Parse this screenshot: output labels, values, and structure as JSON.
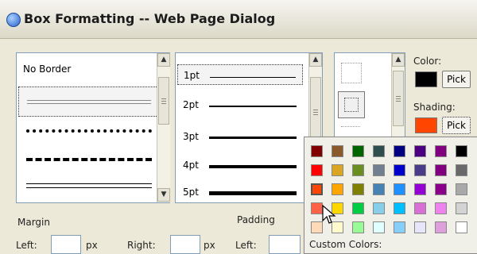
{
  "window": {
    "title": "Box Formatting -- Web Page Dialog"
  },
  "border_list": {
    "items": [
      {
        "label": "No Border",
        "style": "none"
      },
      {
        "label": "",
        "style": "double-thin"
      },
      {
        "label": "",
        "style": "dotted"
      },
      {
        "label": "",
        "style": "dashed"
      },
      {
        "label": "",
        "style": "double"
      }
    ],
    "selected": 1
  },
  "width_list": {
    "items": [
      {
        "label": "1pt",
        "weight": 1
      },
      {
        "label": "2pt",
        "weight": 2
      },
      {
        "label": "3pt",
        "weight": 3
      },
      {
        "label": "4pt",
        "weight": 4
      },
      {
        "label": "5pt",
        "weight": 5
      }
    ],
    "selected": 0
  },
  "preview_list": {
    "items": [
      "outline-all",
      "outline-center",
      "outline-top"
    ],
    "selected": 1
  },
  "color": {
    "label": "Color:",
    "value": "#000000",
    "pick_label": "Pick"
  },
  "shading": {
    "label": "Shading:",
    "value": "#ff4500",
    "pick_label": "Pick"
  },
  "margin": {
    "title": "Margin",
    "left_label": "Left:",
    "unit": "px",
    "right_label": "Right:",
    "right_unit": "px"
  },
  "padding": {
    "title": "Padding",
    "left_label": "Left:"
  },
  "palette": {
    "rows": [
      [
        "#800000",
        "#8b5a2b",
        "#006400",
        "#2f4f4f",
        "#000080",
        "#4b0082",
        "#800080",
        "#000000"
      ],
      [
        "#ff0000",
        "#daa520",
        "#6b8e23",
        "#708090",
        "#0000cd",
        "#4b3c8a",
        "#800080",
        "#696969"
      ],
      [
        "#ff4500",
        "#ffa500",
        "#808000",
        "#4682b4",
        "#1e90ff",
        "#9400d3",
        "#8b008b",
        "#a9a9a9"
      ],
      [
        "#ff6347",
        "#ffd700",
        "#00cc44",
        "#87ceeb",
        "#00bfff",
        "#da70d6",
        "#ee82ee",
        "#d3d3d3"
      ],
      [
        "#ffdab9",
        "#fffacd",
        "#98fb98",
        "#e0ffff",
        "#87cefa",
        "#e6e6fa",
        "#dda0dd",
        "#ffffff"
      ]
    ],
    "selected": [
      2,
      0
    ],
    "custom_label": "Custom Colors:"
  },
  "icons": {
    "up": "scroll-up-arrow",
    "down": "scroll-down-arrow",
    "cursor": "mouse-pointer"
  }
}
